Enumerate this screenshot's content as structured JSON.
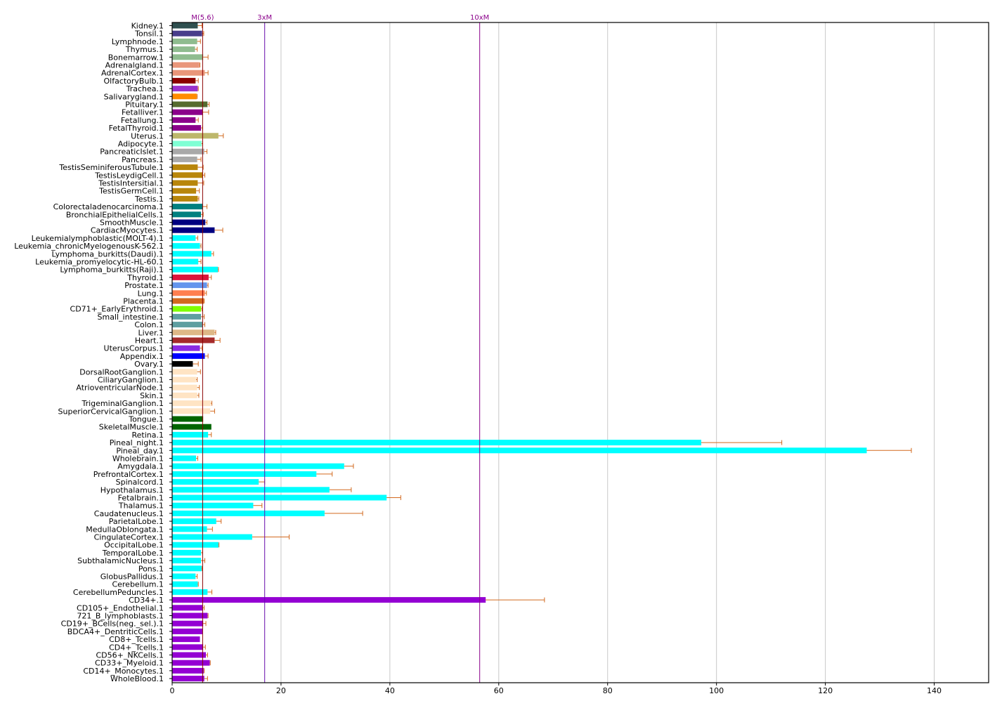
{
  "chart_data": {
    "type": "bar",
    "orientation": "horizontal",
    "xlim": [
      0,
      150
    ],
    "x_ticks": [
      0,
      20,
      40,
      60,
      80,
      100,
      120,
      140
    ],
    "grid": "vertical",
    "error_bar_color": "#D2691E",
    "reference_lines": [
      {
        "label": "M(5.6)",
        "value": 5.6,
        "color": "#8B0000"
      },
      {
        "label": "3xM",
        "value": 17,
        "color": "#6A0DAD"
      },
      {
        "label": "10xM",
        "value": 56.5,
        "color": "#8B008B"
      }
    ],
    "bars": [
      {
        "label": "Kidney.1",
        "value": 4.7,
        "error": 0.8,
        "color": "#2F4F4F"
      },
      {
        "label": "Tonsil.1",
        "value": 5.5,
        "error": 0.3,
        "color": "#483D8B"
      },
      {
        "label": "Lymphnode.1",
        "value": 4.6,
        "error": 0.6,
        "color": "#8FBC8F"
      },
      {
        "label": "Thymus.1",
        "value": 4.2,
        "error": 0.4,
        "color": "#8FBC8F"
      },
      {
        "label": "Bonemarrow.1",
        "value": 5.7,
        "error": 0.9,
        "color": "#8FBC8F"
      },
      {
        "label": "Adrenalgland.1",
        "value": 5.0,
        "error": 0.1,
        "color": "#E9967A"
      },
      {
        "label": "AdrenalCortex.1",
        "value": 6.0,
        "error": 0.6,
        "color": "#E9967A"
      },
      {
        "label": "OlfactoryBulb.1",
        "value": 4.3,
        "error": 0.5,
        "color": "#8B0000"
      },
      {
        "label": "Trachea.1",
        "value": 4.7,
        "error": 0.1,
        "color": "#9932CC"
      },
      {
        "label": "Salivarygland.1",
        "value": 4.5,
        "error": 0.1,
        "color": "#FF8C00"
      },
      {
        "label": "Pituitary.1",
        "value": 6.5,
        "error": 0.3,
        "color": "#556B2F"
      },
      {
        "label": "Fetalliver.1",
        "value": 5.6,
        "error": 1.1,
        "color": "#8B008B"
      },
      {
        "label": "Fetallung.1",
        "value": 4.3,
        "error": 0.5,
        "color": "#8B008B"
      },
      {
        "label": "FetalThyroid.1",
        "value": 5.3,
        "error": 0.3,
        "color": "#8B008B"
      },
      {
        "label": "Uterus.1",
        "value": 8.5,
        "error": 0.9,
        "color": "#BDB76B"
      },
      {
        "label": "Adipocyte.1",
        "value": 5.4,
        "error": 0.2,
        "color": "#7FFFD4"
      },
      {
        "label": "PancreaticIslet.1",
        "value": 5.9,
        "error": 0.5,
        "color": "#A9A9A9"
      },
      {
        "label": "Pancreas.1",
        "value": 4.6,
        "error": 0.7,
        "color": "#A9A9A9"
      },
      {
        "label": "TestisSeminiferousTubule.1",
        "value": 4.7,
        "error": 1.0,
        "color": "#B8860B"
      },
      {
        "label": "TestisLeydigCell.1",
        "value": 5.6,
        "error": 0.4,
        "color": "#B8860B"
      },
      {
        "label": "TestisIntersitial.1",
        "value": 4.7,
        "error": 1.1,
        "color": "#B8860B"
      },
      {
        "label": "TestisGermCell.1",
        "value": 4.4,
        "error": 0.6,
        "color": "#B8860B"
      },
      {
        "label": "Testis.1",
        "value": 4.7,
        "error": 0.2,
        "color": "#B8860B"
      },
      {
        "label": "Colorectaladenocarcinoma.1",
        "value": 5.6,
        "error": 0.8,
        "color": "#008080"
      },
      {
        "label": "BronchialEpithelialCells.1",
        "value": 5.3,
        "error": 0.4,
        "color": "#008080"
      },
      {
        "label": "SmoothMuscle.1",
        "value": 6.1,
        "error": 0.3,
        "color": "#000080"
      },
      {
        "label": "CardiacMyocytes.1",
        "value": 7.8,
        "error": 1.5,
        "color": "#000080"
      },
      {
        "label": "Leukemialymphoblastic(MOLT-4).1",
        "value": 4.3,
        "error": 0.4,
        "color": "#00FFFF"
      },
      {
        "label": "Leukemia_chronicMyelogenousK-562.1",
        "value": 5.1,
        "error": 0.2,
        "color": "#00FFFF"
      },
      {
        "label": "Lymphoma_burkitts(Daudi).1",
        "value": 7.2,
        "error": 0.4,
        "color": "#00FFFF"
      },
      {
        "label": "Leukemia_promyelocytic-HL-60.1",
        "value": 4.8,
        "error": 0.5,
        "color": "#00FFFF"
      },
      {
        "label": "Lymphoma_burkitts(Raji).1",
        "value": 8.4,
        "error": 0.1,
        "color": "#00FFFF"
      },
      {
        "label": "Thyroid.1",
        "value": 6.7,
        "error": 0.5,
        "color": "#DC143C"
      },
      {
        "label": "Prostate.1",
        "value": 6.4,
        "error": 0.2,
        "color": "#6495ED"
      },
      {
        "label": "Lung.1",
        "value": 6.0,
        "error": 0.3,
        "color": "#FF7F50"
      },
      {
        "label": "Placenta.1",
        "value": 5.8,
        "error": 0.1,
        "color": "#D2691E"
      },
      {
        "label": "CD71+_EarlyErythroid.1",
        "value": 5.3,
        "error": 0.2,
        "color": "#7FFF00"
      },
      {
        "label": "Small_intestine.1",
        "value": 5.3,
        "error": 0.6,
        "color": "#5F9EA0"
      },
      {
        "label": "Colon.1",
        "value": 5.6,
        "error": 0.4,
        "color": "#5F9EA0"
      },
      {
        "label": "Liver.1",
        "value": 7.8,
        "error": 0.2,
        "color": "#DEB887"
      },
      {
        "label": "Heart.1",
        "value": 7.8,
        "error": 1.0,
        "color": "#A52A2A"
      },
      {
        "label": "UterusCorpus.1",
        "value": 5.1,
        "error": 0.4,
        "color": "#8A2BE2"
      },
      {
        "label": "Appendix.1",
        "value": 6.0,
        "error": 0.6,
        "color": "#0000FF"
      },
      {
        "label": "Ovary.1",
        "value": 3.8,
        "error": 1.0,
        "color": "#000000"
      },
      {
        "label": "DorsalRootGanglion.1",
        "value": 4.6,
        "error": 0.6,
        "color": "#FFE4C4"
      },
      {
        "label": "CiliaryGanglion.1",
        "value": 4.4,
        "error": 0.2,
        "color": "#FFE4C4"
      },
      {
        "label": "AtrioventricularNode.1",
        "value": 4.6,
        "error": 0.4,
        "color": "#FFE4C4"
      },
      {
        "label": "Skin.1",
        "value": 4.6,
        "error": 0.3,
        "color": "#FFE4C4"
      },
      {
        "label": "TrigeminalGanglion.1",
        "value": 7.1,
        "error": 0.2,
        "color": "#FFE4C4"
      },
      {
        "label": "SuperiorCervicalGanglion.1",
        "value": 7.0,
        "error": 0.8,
        "color": "#FFE4C4"
      },
      {
        "label": "Tongue.1",
        "value": 5.7,
        "error": 0.0,
        "color": "#006400"
      },
      {
        "label": "SkeletalMuscle.1",
        "value": 7.2,
        "error": 0.0,
        "color": "#006400"
      },
      {
        "label": "Retina.1",
        "value": 6.6,
        "error": 0.6,
        "color": "#00FFFF"
      },
      {
        "label": "Pineal_night.1",
        "value": 97.2,
        "error": 14.8,
        "color": "#00FFFF"
      },
      {
        "label": "Pineal_day.1",
        "value": 127.6,
        "error": 8.2,
        "color": "#00FFFF"
      },
      {
        "label": "Wholebrain.1",
        "value": 4.4,
        "error": 0.3,
        "color": "#00FFFF"
      },
      {
        "label": "Amygdala.1",
        "value": 31.6,
        "error": 1.7,
        "color": "#00FFFF"
      },
      {
        "label": "PrefrontalCortex.1",
        "value": 26.5,
        "error": 2.9,
        "color": "#00FFFF"
      },
      {
        "label": "Spinalcord.1",
        "value": 15.9,
        "error": 1.1,
        "color": "#00FFFF"
      },
      {
        "label": "Hypothalamus.1",
        "value": 28.9,
        "error": 4.0,
        "color": "#00FFFF"
      },
      {
        "label": "Fetalbrain.1",
        "value": 39.4,
        "error": 2.6,
        "color": "#00FFFF"
      },
      {
        "label": "Thalamus.1",
        "value": 14.9,
        "error": 1.6,
        "color": "#00FFFF"
      },
      {
        "label": "Caudatenucleus.1",
        "value": 28.0,
        "error": 7.0,
        "color": "#00FFFF"
      },
      {
        "label": "ParietalLobe.1",
        "value": 8.1,
        "error": 0.9,
        "color": "#00FFFF"
      },
      {
        "label": "MedullaOblongata.1",
        "value": 6.4,
        "error": 1.0,
        "color": "#00FFFF"
      },
      {
        "label": "CingulateCortex.1",
        "value": 14.7,
        "error": 6.8,
        "color": "#00FFFF"
      },
      {
        "label": "OccipitalLobe.1",
        "value": 8.5,
        "error": 0.1,
        "color": "#00FFFF"
      },
      {
        "label": "TemporalLobe.1",
        "value": 5.3,
        "error": 0.3,
        "color": "#00FFFF"
      },
      {
        "label": "SubthalamicNucleus.1",
        "value": 5.3,
        "error": 0.7,
        "color": "#00FFFF"
      },
      {
        "label": "Pons.1",
        "value": 5.4,
        "error": 0.1,
        "color": "#00FFFF"
      },
      {
        "label": "GlobusPallidus.1",
        "value": 4.3,
        "error": 0.3,
        "color": "#00FFFF"
      },
      {
        "label": "Cerebellum.1",
        "value": 4.7,
        "error": 0.1,
        "color": "#00FFFF"
      },
      {
        "label": "CerebellumPeduncles.1",
        "value": 6.5,
        "error": 0.8,
        "color": "#00FFFF"
      },
      {
        "label": "CD34+.1",
        "value": 57.6,
        "error": 10.8,
        "color": "#9400D3"
      },
      {
        "label": "CD105+_Endothelial.1",
        "value": 5.6,
        "error": 0.3,
        "color": "#9400D3"
      },
      {
        "label": "721_B_lymphoblasts.1",
        "value": 6.5,
        "error": 0.1,
        "color": "#9400D3"
      },
      {
        "label": "CD19+_BCells(neg._sel.).1",
        "value": 5.7,
        "error": 0.5,
        "color": "#9400D3"
      },
      {
        "label": "BDCA4+_DentriticCells.1",
        "value": 5.6,
        "error": 0.0,
        "color": "#9400D3"
      },
      {
        "label": "CD8+_Tcells.1",
        "value": 5.1,
        "error": 0.0,
        "color": "#9400D3"
      },
      {
        "label": "CD4+_Tcells.1",
        "value": 5.7,
        "error": 0.4,
        "color": "#9400D3"
      },
      {
        "label": "CD56+_NKCells.1",
        "value": 6.2,
        "error": 0.3,
        "color": "#9400D3"
      },
      {
        "label": "CD33+_Myeloid.1",
        "value": 6.9,
        "error": 0.1,
        "color": "#9400D3"
      },
      {
        "label": "CD14+_Monocytes.1",
        "value": 5.8,
        "error": 0.1,
        "color": "#9400D3"
      },
      {
        "label": "WholeBlood.1",
        "value": 5.9,
        "error": 0.6,
        "color": "#9400D3"
      }
    ]
  }
}
